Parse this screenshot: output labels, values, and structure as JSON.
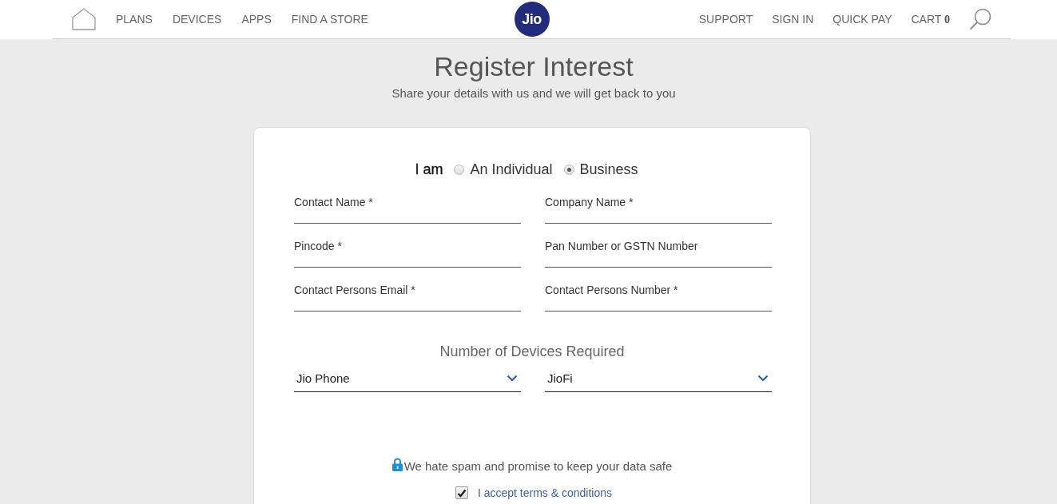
{
  "header": {
    "nav_left": [
      "PLANS",
      "DEVICES",
      "APPS",
      "FIND A STORE"
    ],
    "logo": "Jio",
    "nav_right": [
      "SUPPORT",
      "SIGN IN",
      "QUICK PAY"
    ],
    "cart": {
      "label": "CART",
      "count": "0"
    }
  },
  "title": "Register Interest",
  "subtitle": "Share your details with us and we will get back to you",
  "form": {
    "type_label": "I am",
    "type_options": [
      {
        "label": "An Individual",
        "selected": false
      },
      {
        "label": "Business",
        "selected": true
      }
    ],
    "fields": [
      {
        "placeholder": "Contact Name *"
      },
      {
        "placeholder": "Company Name *"
      },
      {
        "placeholder": "Pincode *"
      },
      {
        "placeholder": "Pan Number or GSTN Number"
      },
      {
        "placeholder": "Contact Persons Email *"
      },
      {
        "placeholder": "Contact Persons Number *"
      }
    ],
    "devices_heading": "Number of Devices Required",
    "device_selects": [
      {
        "value": "Jio Phone"
      },
      {
        "value": "JioFi"
      }
    ],
    "privacy_note": "We hate spam and promise to keep your data safe",
    "terms": {
      "label": "I accept terms & conditions",
      "checked": true
    }
  }
}
